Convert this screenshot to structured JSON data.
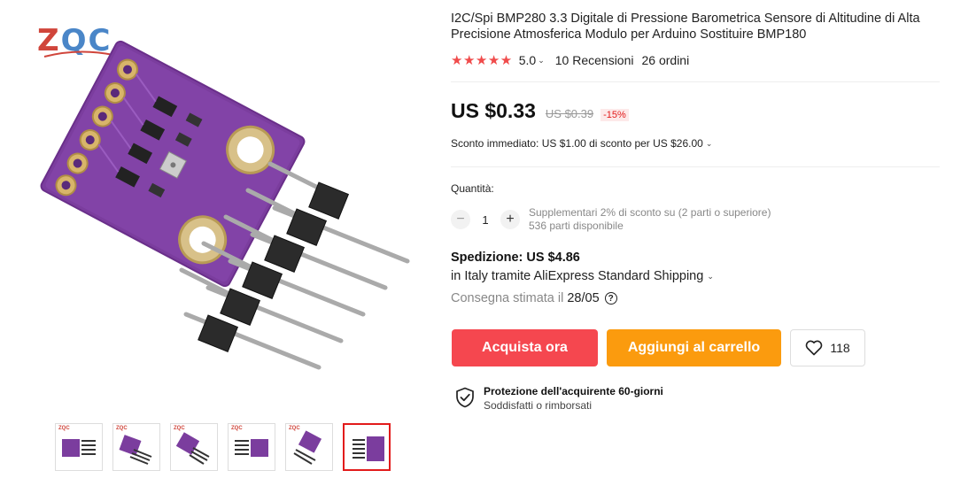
{
  "product": {
    "title": "I2C/Spi BMP280 3.3 Digitale di Pressione Barometrica Sensore di Altitudine di Alta Precisione Atmosferica Modulo per Arduino Sostituire BMP180",
    "rating": "5.0",
    "reviews": "10 Recensioni",
    "orders": "26 ordini"
  },
  "brand": {
    "logo_letter": "Z",
    "logo_rest": "QC"
  },
  "price": {
    "current": "US $0.33",
    "original": "US $0.39",
    "discount": "-15%"
  },
  "instant_discount": "Sconto immediato: US $1.00 di sconto per US $26.00",
  "quantity": {
    "label": "Quantità:",
    "value": "1",
    "minus": "−",
    "plus": "+",
    "extra_discount": "Supplementari 2% di sconto su (2 parti o superiore)",
    "available": "536 parti disponibile"
  },
  "shipping": {
    "title": "Spedizione: US $4.86",
    "method": "in Italy tramite AliExpress Standard Shipping",
    "delivery_label": "Consegna stimata il",
    "delivery_date": "28/05",
    "help": "?"
  },
  "actions": {
    "buy_now": "Acquista ora",
    "add_to_cart": "Aggiungi al carrello",
    "wishlist_count": "118"
  },
  "protection": {
    "title": "Protezione dell'acquirente 60-giorni",
    "subtitle": "Soddisfatti o rimborsati"
  },
  "gallery": {
    "thumbnails": [
      {
        "logo": "ZQC"
      },
      {
        "logo": "ZQC"
      },
      {
        "logo": "ZQC"
      },
      {
        "logo": "ZQC"
      },
      {
        "logo": "ZQC"
      },
      {
        "logo": ""
      }
    ],
    "active_index": 5
  },
  "colors": {
    "star": "#f04b4b",
    "buy_now": "#f5474f",
    "add_to_cart": "#fb9b0e",
    "pcb": "#7b3d9e",
    "active_border": "#e21b1b"
  },
  "icons": {
    "rating": "star-icon",
    "chevron": "chevron-down-icon",
    "help": "help-circle-icon",
    "wishlist": "heart-icon",
    "protection": "shield-check-icon"
  }
}
